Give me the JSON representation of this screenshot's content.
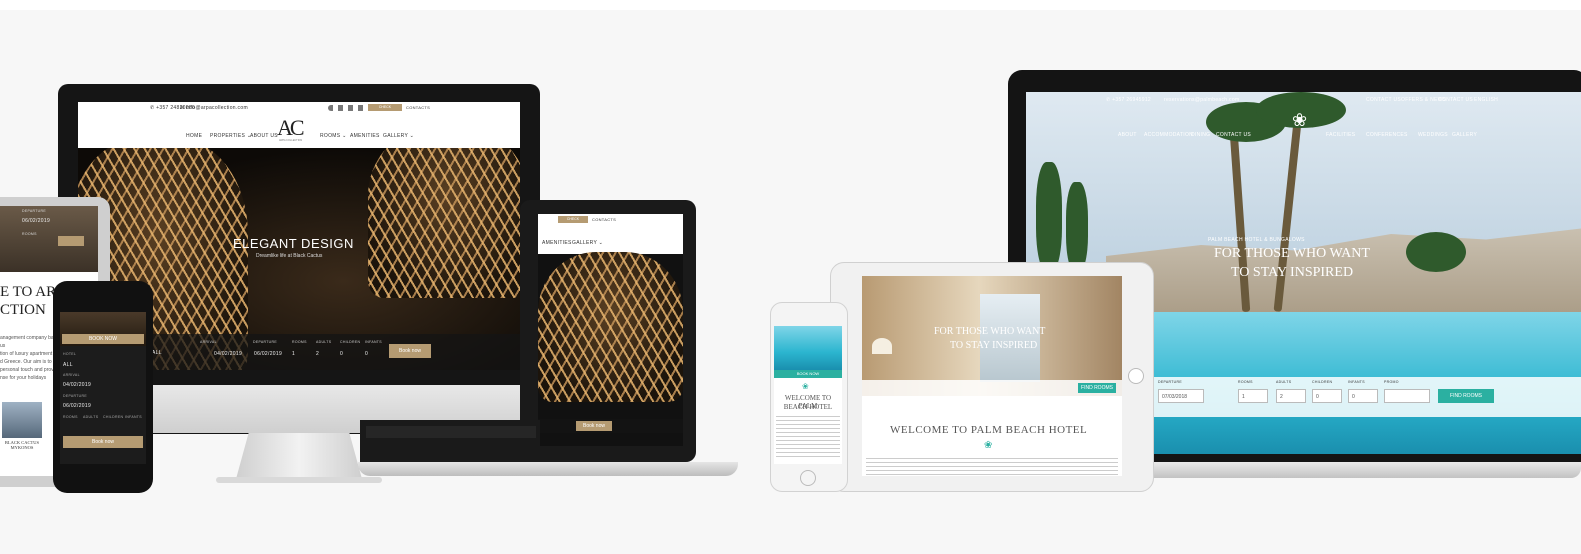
{
  "left_mockup": {
    "imac": {
      "top_bar": {
        "phone": "✆ +357 24820880",
        "email": "✉ info@arpacollection.com",
        "availability": "CHECK AVAILABILITY",
        "contacts": "CONTACTS"
      },
      "menu": [
        "HOME",
        "PROPERTIES ⌄",
        "ABOUT US",
        "ROOMS ⌄",
        "AMENITIES",
        "GALLERY ⌄"
      ],
      "logo": "AC",
      "logo_sub": "ARPA COLLECTION",
      "hero_title": "ELEGANT DESIGN",
      "hero_subtitle": "Dreamlike life at Black Cactus",
      "booking_labels": [
        "ARRIVAL",
        "DEPARTURE",
        "ROOMS",
        "ADULTS",
        "CHILDREN",
        "INFANTS"
      ],
      "arrival": "04/02/2019",
      "departure": "06/02/2019",
      "rooms": "1",
      "adults": "2",
      "children": "0",
      "infants": "0",
      "book_button": "Book now",
      "hotel_select": "ALL"
    },
    "laptop": {
      "availability": "CHECK AVAILABILITY",
      "contacts": "CONTACTS",
      "menu": [
        "AMENITIES",
        "GALLERY ⌄"
      ],
      "book_button": "Book now"
    },
    "tablet": {
      "labels": [
        "DEPARTURE",
        "ROOMS"
      ],
      "date": "06/02/2019",
      "heading": "E TO ARPA",
      "heading2": "CTION",
      "body_lines": [
        "anagement company bas",
        "us",
        "tion of luxury apartment",
        "d Greece. Our aim is to p",
        "personal touch and prov",
        "nse for your holidays"
      ],
      "caption": "BLACK CACTUS MYKONOS"
    },
    "phone": {
      "book_banner": "BOOK NOW",
      "hotel_label": "HOTEL",
      "hotel_value": "ALL",
      "arrival_label": "ARRIVAL",
      "arrival": "04/02/2019",
      "departure_label": "DEPARTURE",
      "departure": "06/02/2019",
      "labels": [
        "ROOMS",
        "ADULTS",
        "CHILDREN",
        "INFANTS"
      ],
      "book_button": "Book now"
    }
  },
  "right_mockup": {
    "laptop": {
      "top_bar": {
        "phone": "✆ +357 26945912",
        "email": "reservations@palmbeach.com",
        "links": [
          "CONTACT US",
          "OFFERS & NEWS",
          "CONTACT US",
          "ENGLISH"
        ]
      },
      "menu": [
        "ABOUT",
        "ACCOMMODATION",
        "DINING",
        "CONTACT US",
        "❀",
        "FACILITIES",
        "CONFERENCES",
        "WEDDINGS",
        "GALLERY"
      ],
      "hero_kicker": "PALM BEACH HOTEL & BUNGALOWS",
      "hero_line1": "FOR THOSE WHO WANT",
      "hero_line2": "TO STAY INSPIRED",
      "booking_labels": [
        "DEPARTURE",
        "ROOMS",
        "ADULTS",
        "CHILDREN",
        "INFANTS",
        "PROMO"
      ],
      "departure": "07/03/2018",
      "rooms": "1",
      "adults": "2",
      "children": "0",
      "infants": "0",
      "book_button": "FIND ROOMS"
    },
    "tablet": {
      "hero_line1": "FOR THOSE WHO WANT",
      "hero_line2": "TO STAY INSPIRED",
      "welcome": "WELCOME TO PALM BEACH HOTEL",
      "book_button": "FIND ROOMS"
    },
    "phone": {
      "banner": "BOOK NOW",
      "welcome1": "WELCOME TO PALM",
      "welcome2": "BEACH HOTEL"
    }
  },
  "colors": {
    "gold": "#b59b72",
    "teal": "#2bb0a1",
    "background": "#f7f7f7"
  }
}
